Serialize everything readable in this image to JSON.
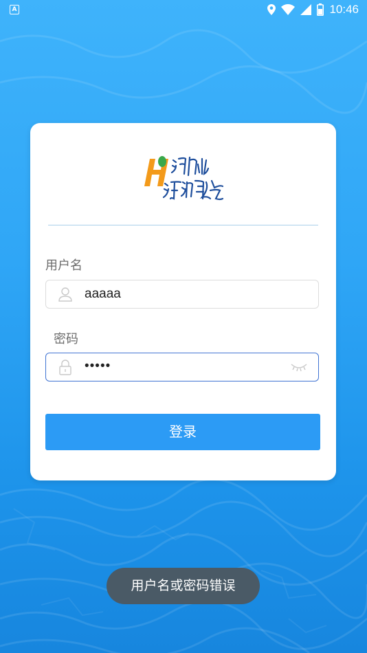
{
  "status_bar": {
    "notification_icon": "A",
    "time": "10:46",
    "icons": [
      "location-icon",
      "wifi-icon",
      "signal-icon",
      "battery-icon"
    ]
  },
  "login": {
    "username_label": "用户名",
    "username_value": "aaaaa",
    "password_label": "密码",
    "password_value": "•••••",
    "submit_label": "登录"
  },
  "toast": {
    "message": "用户名或密码错误"
  },
  "colors": {
    "background": "#2fa6f6",
    "button": "#2c9bf5",
    "focus_border": "#3f73d3",
    "toast_bg": "#4a5a66"
  }
}
